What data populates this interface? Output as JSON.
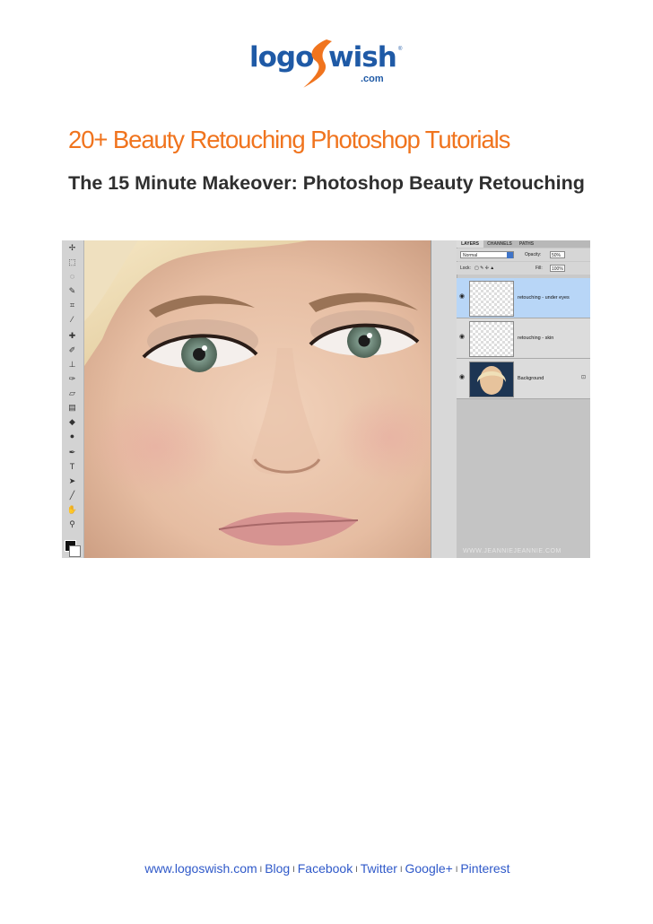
{
  "logo": {
    "part1": "logo",
    "part2": "wish",
    "domain": ".com",
    "registered": "®"
  },
  "page_title": "20+ Beauty Retouching Photoshop Tutorials",
  "subtitle": "The 15 Minute Makeover: Photoshop Beauty Retouching",
  "figure": {
    "tabs": [
      "LAYERS",
      "CHANNELS",
      "PATHS"
    ],
    "blend_mode": "Normal",
    "opacity_label": "Opacity:",
    "opacity_value": "50%",
    "lock_label": "Lock:",
    "fill_label": "Fill:",
    "fill_value": "100%",
    "layers": [
      {
        "name": "retouching - under eyes",
        "active": true
      },
      {
        "name": "retouching - skin",
        "active": false
      },
      {
        "name": "Background",
        "active": false
      }
    ],
    "watermark": "WWW.JEANNIEJEANNIE.COM"
  },
  "footer": {
    "links": [
      "www.logoswish.com",
      "Blog",
      "Facebook",
      "Twitter",
      "Google+",
      "Pinterest"
    ],
    "separator": "I"
  },
  "colors": {
    "title_orange": "#f0741e",
    "logo_blue": "#1f5aa6",
    "footer_link": "#2f59c9"
  }
}
